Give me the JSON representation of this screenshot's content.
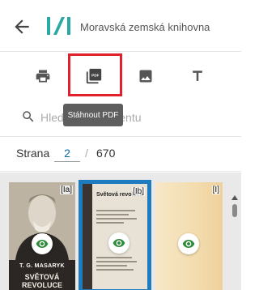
{
  "header": {
    "back_icon": "arrow-left-icon",
    "logo_icon": "mzk-logo-icon",
    "brand_name": "Moravská zemská knihovna",
    "accent_color": "#29a8a4"
  },
  "toolbar": {
    "items": [
      {
        "id": "print",
        "icon": "printer-icon"
      },
      {
        "id": "pdf",
        "icon": "pdf-icon",
        "highlighted": true,
        "highlight_color": "#e0202a"
      },
      {
        "id": "image",
        "icon": "image-icon"
      },
      {
        "id": "text",
        "icon": "text-icon"
      }
    ],
    "tooltip": "Stáhnout PDF"
  },
  "search": {
    "icon": "search-icon",
    "placeholder": "Hledat v dokumentu"
  },
  "pager": {
    "label": "Strana",
    "current_page": "2",
    "separator": "/",
    "total_pages": "670"
  },
  "thumbnails": [
    {
      "label": "[Ia]",
      "cover_title": "T. G. MASARYK",
      "cover_subtitle": "SVĚTOVÁ REVOLUCE",
      "selected": false
    },
    {
      "label": "[Ib]",
      "cover_title": "Světová revoluce",
      "selected": true,
      "selected_color": "#1e7bc0"
    },
    {
      "label": "[I]",
      "selected": false
    }
  ]
}
